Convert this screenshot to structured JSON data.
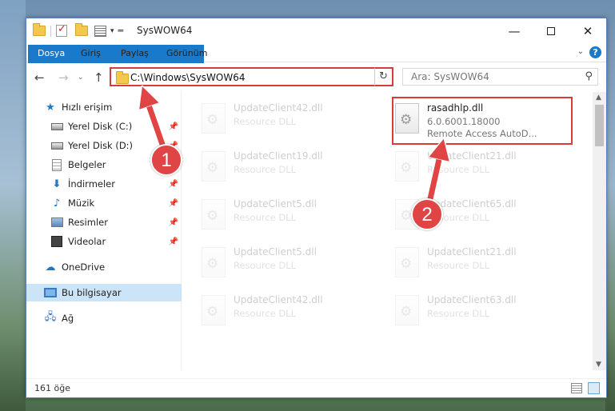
{
  "window": {
    "title": "SysWOW64",
    "minimize_glyph": "—",
    "close_glyph": "✕"
  },
  "ribbon": {
    "tabs": [
      "Dosya",
      "Giriş",
      "Paylaş",
      "Görünüm"
    ],
    "help_glyph": "?"
  },
  "navbar": {
    "address": "C:\\Windows\\SysWOW64",
    "search_placeholder": "Ara: SysWOW64"
  },
  "sidebar": {
    "items": [
      {
        "label": "Hızlı erişim",
        "icon": "star-icon"
      },
      {
        "label": "Yerel Disk (C:)",
        "icon": "disk-icon",
        "pinned": true
      },
      {
        "label": "Yerel Disk (D:)",
        "icon": "disk-icon",
        "pinned": true
      },
      {
        "label": "Belgeler",
        "icon": "document-icon",
        "pinned": true
      },
      {
        "label": "İndirmeler",
        "icon": "download-icon",
        "pinned": true
      },
      {
        "label": "Müzik",
        "icon": "music-icon",
        "pinned": true
      },
      {
        "label": "Resimler",
        "icon": "pictures-icon",
        "pinned": true
      },
      {
        "label": "Videolar",
        "icon": "videos-icon",
        "pinned": true
      },
      {
        "label": "OneDrive",
        "icon": "cloud-icon"
      },
      {
        "label": "Bu bilgisayar",
        "icon": "computer-icon",
        "selected": true
      },
      {
        "label": "Ağ",
        "icon": "network-icon"
      }
    ]
  },
  "files": {
    "highlighted": {
      "name": "rasadhlp.dll",
      "version": "6.0.6001.18000",
      "description": "Remote Access AutoD..."
    },
    "left_column": [
      {
        "name": "UpdateClient42.dll",
        "type": "Resource DLL"
      },
      {
        "name": "UpdateClient19.dll",
        "type": "Resource DLL"
      },
      {
        "name": "UpdateClient5.dll",
        "type": "Resource DLL"
      },
      {
        "name": "UpdateClient5.dll",
        "type": "Resource DLL"
      },
      {
        "name": "UpdateClient42.dll",
        "type": "Resource DLL"
      }
    ],
    "right_column": [
      {
        "name": "UpdateClient21.dll",
        "type": "Resource DLL"
      },
      {
        "name": "UpdateClient65.dll",
        "type": "Resource DLL"
      },
      {
        "name": "UpdateClient21.dll",
        "type": "Resource DLL"
      },
      {
        "name": "UpdateClient63.dll",
        "type": "Resource DLL"
      }
    ]
  },
  "status": {
    "item_count": "161 öğe"
  },
  "annotations": {
    "step1": "1",
    "step2": "2",
    "color": "#e04545"
  }
}
